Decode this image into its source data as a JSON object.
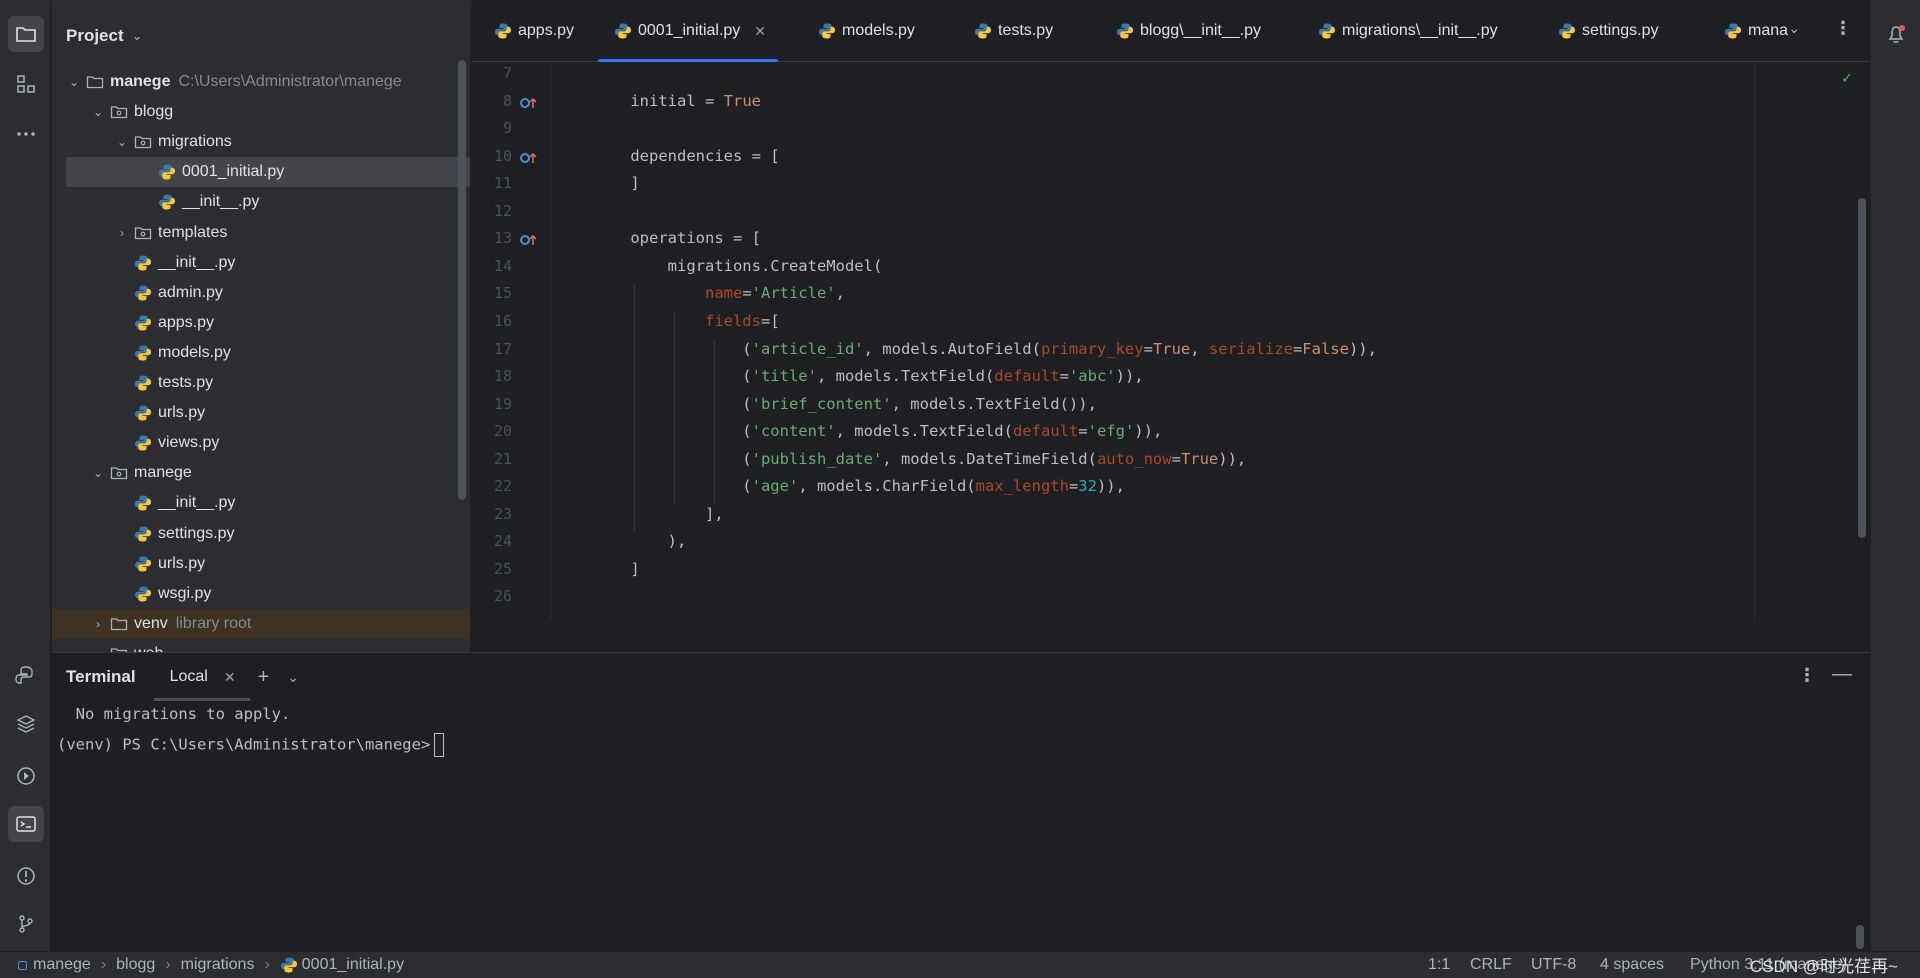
{
  "project_panel": {
    "title": "Project",
    "tree": [
      {
        "label": "manege",
        "hint": "C:\\Users\\Administrator\\manege",
        "type": "folder",
        "expanded": true,
        "bold": true
      },
      {
        "label": "blogg",
        "type": "package",
        "expanded": true
      },
      {
        "label": "migrations",
        "type": "package",
        "expanded": true
      },
      {
        "label": "0001_initial.py",
        "type": "python",
        "selected": true
      },
      {
        "label": "__init__.py",
        "type": "python"
      },
      {
        "label": "templates",
        "type": "package",
        "expanded": false
      },
      {
        "label": "__init__.py",
        "type": "python"
      },
      {
        "label": "admin.py",
        "type": "python"
      },
      {
        "label": "apps.py",
        "type": "python"
      },
      {
        "label": "models.py",
        "type": "python"
      },
      {
        "label": "tests.py",
        "type": "python"
      },
      {
        "label": "urls.py",
        "type": "python"
      },
      {
        "label": "views.py",
        "type": "python"
      },
      {
        "label": "manege",
        "type": "package",
        "expanded": true
      },
      {
        "label": "__init__.py",
        "type": "python"
      },
      {
        "label": "settings.py",
        "type": "python"
      },
      {
        "label": "urls.py",
        "type": "python"
      },
      {
        "label": "wsgi.py",
        "type": "python"
      },
      {
        "label": "venv",
        "hint": "library root",
        "type": "folder",
        "expanded": false
      },
      {
        "label": "web",
        "type": "folder",
        "expanded": false
      }
    ]
  },
  "tabs": [
    {
      "label": "apps.py"
    },
    {
      "label": "0001_initial.py",
      "active": true
    },
    {
      "label": "models.py"
    },
    {
      "label": "tests.py"
    },
    {
      "label": "blogg\\__init__.py"
    },
    {
      "label": "migrations\\__init__.py"
    },
    {
      "label": "settings.py"
    },
    {
      "label": "mana"
    }
  ],
  "editor": {
    "lines": [
      {
        "n": "7",
        "tokens": []
      },
      {
        "n": "8",
        "mark": true,
        "tokens": [
          [
            "    initial = ",
            ""
          ],
          [
            "True",
            "kw"
          ]
        ]
      },
      {
        "n": "9",
        "tokens": []
      },
      {
        "n": "10",
        "mark": true,
        "tokens": [
          [
            "    dependencies = [",
            ""
          ]
        ]
      },
      {
        "n": "11",
        "tokens": [
          [
            "    ]",
            ""
          ]
        ]
      },
      {
        "n": "12",
        "tokens": []
      },
      {
        "n": "13",
        "mark": true,
        "tokens": [
          [
            "    operations = [",
            ""
          ]
        ]
      },
      {
        "n": "14",
        "tokens": [
          [
            "        migrations.CreateModel(",
            ""
          ]
        ]
      },
      {
        "n": "15",
        "tokens": [
          [
            "            ",
            ""
          ],
          [
            "name",
            "param"
          ],
          [
            "=",
            ""
          ],
          [
            "'Article'",
            "str"
          ],
          [
            ",",
            ""
          ]
        ]
      },
      {
        "n": "16",
        "tokens": [
          [
            "            ",
            ""
          ],
          [
            "fields",
            "param"
          ],
          [
            "=[",
            ""
          ]
        ]
      },
      {
        "n": "17",
        "tokens": [
          [
            "                (",
            ""
          ],
          [
            "'article_id'",
            "str"
          ],
          [
            ", models.AutoField(",
            ""
          ],
          [
            "primary_key",
            "param"
          ],
          [
            "=",
            ""
          ],
          [
            "True",
            "kw"
          ],
          [
            ", ",
            ""
          ],
          [
            "serialize",
            "param"
          ],
          [
            "=",
            ""
          ],
          [
            "False",
            "kw"
          ],
          [
            ")),",
            ""
          ]
        ]
      },
      {
        "n": "18",
        "tokens": [
          [
            "                (",
            ""
          ],
          [
            "'title'",
            "str"
          ],
          [
            ", models.TextField(",
            ""
          ],
          [
            "default",
            "param"
          ],
          [
            "=",
            ""
          ],
          [
            "'abc'",
            "str"
          ],
          [
            ")),",
            ""
          ]
        ]
      },
      {
        "n": "19",
        "tokens": [
          [
            "                (",
            ""
          ],
          [
            "'brief_content'",
            "str"
          ],
          [
            ", models.TextField()),",
            ""
          ]
        ]
      },
      {
        "n": "20",
        "tokens": [
          [
            "                (",
            ""
          ],
          [
            "'content'",
            "str"
          ],
          [
            ", models.TextField(",
            ""
          ],
          [
            "default",
            "param"
          ],
          [
            "=",
            ""
          ],
          [
            "'efg'",
            "str"
          ],
          [
            ")),",
            ""
          ]
        ]
      },
      {
        "n": "21",
        "tokens": [
          [
            "                (",
            ""
          ],
          [
            "'publish_date'",
            "str"
          ],
          [
            ", models.DateTimeField(",
            ""
          ],
          [
            "auto_now",
            "param"
          ],
          [
            "=",
            ""
          ],
          [
            "True",
            "kw"
          ],
          [
            ")),",
            ""
          ]
        ]
      },
      {
        "n": "22",
        "tokens": [
          [
            "                (",
            ""
          ],
          [
            "'age'",
            "str"
          ],
          [
            ", models.CharField(",
            ""
          ],
          [
            "max_length",
            "param"
          ],
          [
            "=",
            ""
          ],
          [
            "32",
            "num"
          ],
          [
            ")),",
            ""
          ]
        ]
      },
      {
        "n": "23",
        "tokens": [
          [
            "            ],",
            ""
          ]
        ]
      },
      {
        "n": "24",
        "tokens": [
          [
            "        ),",
            ""
          ]
        ]
      },
      {
        "n": "25",
        "tokens": [
          [
            "    ]",
            ""
          ]
        ]
      },
      {
        "n": "26",
        "tokens": []
      }
    ]
  },
  "terminal": {
    "title": "Terminal",
    "tab_label": "Local",
    "lines": [
      "  No migrations to apply.",
      "(venv) PS C:\\Users\\Administrator\\manege>"
    ]
  },
  "status_bar": {
    "breadcrumbs": [
      "manege",
      "blogg",
      "migrations",
      "0001_initial.py"
    ],
    "position": "1:1",
    "line_ending": "CRLF",
    "encoding": "UTF-8",
    "indent": "4 spaces",
    "interpreter": "Python 3.11 (manege)"
  },
  "watermark": "CSDN @时光荏再~",
  "colors": {
    "accent": "#3574f0",
    "keyword": "#cf8e6d",
    "string": "#6aab73",
    "param": "#aa4926",
    "number": "#2aacb8"
  }
}
